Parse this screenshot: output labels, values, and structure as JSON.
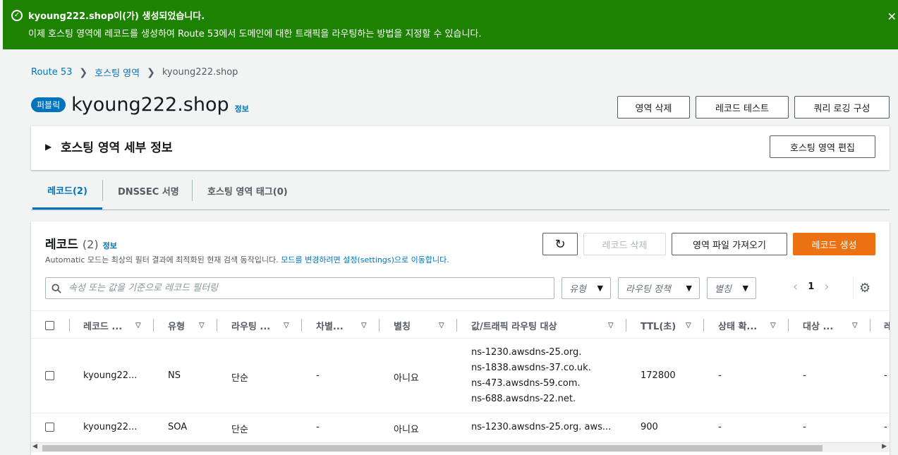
{
  "flash": {
    "title": "kyoung222.shop이(가) 생성되었습니다.",
    "message": "이제 호스팅 영역에 레코드를 생성하여 Route 53에서 도메인에 대한 트래픽을 라우팅하는 방법을 지정할 수 있습니다.",
    "check_icon": "✓",
    "close_icon": "✕",
    "color": "#1d8102"
  },
  "breadcrumb": {
    "items": [
      "Route 53",
      "호스팅 영역"
    ],
    "current": "kyoung222.shop",
    "separator": "❯"
  },
  "header": {
    "badge": "퍼블릭",
    "title": "kyoung222.shop",
    "info": "정보",
    "buttons": {
      "delete_zone": "영역 삭제",
      "test_record": "레코드 테스트",
      "query_logging": "쿼리 로깅 구성"
    }
  },
  "details": {
    "caret": "▶",
    "heading": "호스팅 영역 세부 정보",
    "edit_button": "호스팅 영역 편집"
  },
  "tabs": [
    {
      "label": "레코드(2)",
      "active": true
    },
    {
      "label": "DNSSEC 서명",
      "active": false
    },
    {
      "label": "호스팅 영역 태그(0)",
      "active": false
    }
  ],
  "records": {
    "title": "레코드",
    "count": "(2)",
    "info": "정보",
    "description": "Automatic 모드는 최상의 필터 결과에 최적화된 현재 검색 동작입니다. ",
    "description_link": "모드를 변경하려면 설정(settings)으로 이동합니다.",
    "buttons": {
      "refresh_icon": "↻",
      "delete": "레코드 삭제",
      "import": "영역 파일 가져오기",
      "create": "레코드 생성"
    },
    "search_placeholder": "속성 또는 값을 기준으로 레코드 필터링",
    "filters": {
      "type": "유형",
      "routing_policy": "라우팅 정책",
      "alias": "별칭"
    },
    "page": "1",
    "columns": [
      "레코드 ...",
      "유형",
      "라우팅 ...",
      "차별...",
      "별칭",
      "값/트래픽 라우팅 대상",
      "TTL(초)",
      "상태 확...",
      "대상 ...",
      "레"
    ],
    "rows": [
      {
        "name": "kyoung22...",
        "type": "NS",
        "routing": "단순",
        "differentiator": "-",
        "alias": "아니요",
        "values": [
          "ns-1230.awsdns-25.org.",
          "ns-1838.awsdns-37.co.uk.",
          "ns-473.awsdns-59.com.",
          "ns-688.awsdns-22.net."
        ],
        "ttl": "172800",
        "health": "-",
        "target": "-",
        "extra": "-"
      },
      {
        "name": "kyoung22...",
        "type": "SOA",
        "routing": "단순",
        "differentiator": "-",
        "alias": "아니요",
        "values": [
          "ns-1230.awsdns-25.org. aws..."
        ],
        "ttl": "900",
        "health": "-",
        "target": "-",
        "extra": "-"
      }
    ]
  },
  "colors": {
    "link": "#0073bb",
    "primary": "#ec7211",
    "background": "#f2f3f3"
  }
}
